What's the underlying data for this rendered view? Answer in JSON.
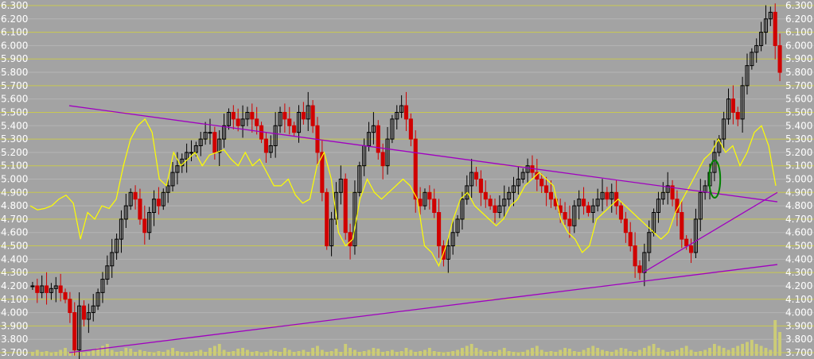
{
  "chart_data": {
    "type": "candlestick",
    "title": "",
    "xlabel": "",
    "ylabel": "",
    "ylim": [
      3.7,
      6.3
    ],
    "yticks": [
      "6.300",
      "6.200",
      "6.100",
      "6.000",
      "5.900",
      "5.800",
      "5.700",
      "5.600",
      "5.500",
      "5.400",
      "5.300",
      "5.200",
      "5.100",
      "5.000",
      "4.900",
      "4.800",
      "4.700",
      "4.600",
      "4.500",
      "4.400",
      "4.300",
      "4.200",
      "4.100",
      "4.000",
      "3.900",
      "3.800",
      "3.700"
    ],
    "grid": true,
    "legend": "none",
    "colors": {
      "background": "#a3a3a3",
      "up_candle": "#000000",
      "down_candle": "#d00000",
      "moving_average": "#ffff00",
      "trendline": "#a000c0",
      "volume": "#cccc77",
      "highlight": "#008000",
      "gridline_major": "#c8c850",
      "gridline_minor": "#b4b4b4"
    },
    "series": [
      {
        "kind": "close_approx",
        "values": [
          4.2,
          4.15,
          4.2,
          4.15,
          4.18,
          4.2,
          4.15,
          4.1,
          4.0,
          3.72,
          4.05,
          3.95,
          4.0,
          4.05,
          4.15,
          4.25,
          4.35,
          4.45,
          4.55,
          4.7,
          4.8,
          4.9,
          4.85,
          4.7,
          4.6,
          4.75,
          4.85,
          4.8,
          4.9,
          4.95,
          5.05,
          5.1,
          5.15,
          5.2,
          5.2,
          5.25,
          5.3,
          5.35,
          5.35,
          5.2,
          5.3,
          5.4,
          5.5,
          5.45,
          5.4,
          5.45,
          5.5,
          5.45,
          5.4,
          5.3,
          5.2,
          5.25,
          5.4,
          5.5,
          5.45,
          5.4,
          5.35,
          5.5,
          5.45,
          5.55,
          5.4,
          5.2,
          4.9,
          4.5,
          4.7,
          4.9,
          5.0,
          4.6,
          4.5,
          4.9,
          5.1,
          5.25,
          5.35,
          5.4,
          5.2,
          5.1,
          5.3,
          5.45,
          5.5,
          5.55,
          5.45,
          5.3,
          4.85,
          4.8,
          4.9,
          4.85,
          4.75,
          4.5,
          4.4,
          4.5,
          4.6,
          4.7,
          4.85,
          4.95,
          5.05,
          5.0,
          4.9,
          4.85,
          4.8,
          4.75,
          4.8,
          4.85,
          4.9,
          4.95,
          5.0,
          5.05,
          5.1,
          5.05,
          5.0,
          4.95,
          4.9,
          4.85,
          4.8,
          4.75,
          4.7,
          4.65,
          4.8,
          4.85,
          4.8,
          4.75,
          4.8,
          4.85,
          4.9,
          4.85,
          4.9,
          4.8,
          4.7,
          4.6,
          4.5,
          4.35,
          4.3,
          4.45,
          4.6,
          4.75,
          4.85,
          4.9,
          4.95,
          4.85,
          4.75,
          4.55,
          4.5,
          4.45,
          4.7,
          4.9,
          4.95,
          5.05,
          5.2,
          5.3,
          5.45,
          5.6,
          5.5,
          5.45,
          5.7,
          5.85,
          5.95,
          6.0,
          6.1,
          6.2,
          6.25,
          6.0,
          5.8
        ]
      },
      {
        "kind": "moving_average",
        "values": [
          4.8,
          4.77,
          4.78,
          4.8,
          4.85,
          4.88,
          4.82,
          4.55,
          4.75,
          4.7,
          4.8,
          4.78,
          4.85,
          5.1,
          5.3,
          5.4,
          5.45,
          5.35,
          5.0,
          4.95,
          5.2,
          5.1,
          5.15,
          5.2,
          5.1,
          5.18,
          5.2,
          5.22,
          5.15,
          5.1,
          5.2,
          5.1,
          5.15,
          5.05,
          4.95,
          4.95,
          5.0,
          4.88,
          4.82,
          4.85,
          5.1,
          5.2,
          5.0,
          4.6,
          4.5,
          4.55,
          4.85,
          5.0,
          4.9,
          4.85,
          4.9,
          4.95,
          5.0,
          4.95,
          4.85,
          4.5,
          4.45,
          4.35,
          4.5,
          4.7,
          4.85,
          4.9,
          4.8,
          4.75,
          4.7,
          4.65,
          4.7,
          4.8,
          4.85,
          4.95,
          5.0,
          5.05,
          5.0,
          4.95,
          4.7,
          4.6,
          4.55,
          4.45,
          4.5,
          4.7,
          4.75,
          4.8,
          4.85,
          4.8,
          4.75,
          4.7,
          4.65,
          4.6,
          4.55,
          4.6,
          4.75,
          4.85,
          4.95,
          5.05,
          5.15,
          5.2,
          5.3,
          5.2,
          5.25,
          5.1,
          5.2,
          5.35,
          5.4,
          5.25,
          4.95
        ]
      },
      {
        "kind": "volume_relative",
        "values": [
          0.1,
          0.15,
          0.1,
          0.12,
          0.08,
          0.1,
          0.15,
          0.2,
          0.1,
          0.12,
          0.1,
          0.08,
          0.1,
          0.15,
          0.2,
          0.25,
          0.3,
          0.15,
          0.1,
          0.12,
          0.2,
          0.18,
          0.1,
          0.15,
          0.12,
          0.1,
          0.08,
          0.12,
          0.1,
          0.15,
          0.2,
          0.12,
          0.1,
          0.08,
          0.1,
          0.12,
          0.15,
          0.1,
          0.2,
          0.25,
          0.3,
          0.15,
          0.1,
          0.12,
          0.18,
          0.2,
          0.15,
          0.1,
          0.12,
          0.08,
          0.1,
          0.15,
          0.12,
          0.1,
          0.2,
          0.15,
          0.1,
          0.12,
          0.15,
          0.1,
          0.2,
          0.25,
          0.15,
          0.1,
          0.12,
          0.18,
          0.1,
          0.3,
          0.2,
          0.15,
          0.1,
          0.12,
          0.15,
          0.2,
          0.18,
          0.1,
          0.12,
          0.15,
          0.1,
          0.12,
          0.2,
          0.15,
          0.1,
          0.12,
          0.15,
          0.2,
          0.12,
          0.1,
          0.08,
          0.1,
          0.12,
          0.15,
          0.2,
          0.25,
          0.3,
          0.2,
          0.15,
          0.1,
          0.12,
          0.1,
          0.15,
          0.2,
          0.12,
          0.1,
          0.08,
          0.1,
          0.15,
          0.2,
          0.25,
          0.15,
          0.1,
          0.12,
          0.1,
          0.15,
          0.2,
          0.18,
          0.12,
          0.1,
          0.15,
          0.2,
          0.25,
          0.2,
          0.15,
          0.12,
          0.1,
          0.15,
          0.2,
          0.18,
          0.12,
          0.1,
          0.15,
          0.2,
          0.25,
          0.3,
          0.2,
          0.15,
          0.1,
          0.12,
          0.15,
          0.2,
          0.25,
          0.15,
          0.1,
          0.12,
          0.15,
          0.2,
          0.3,
          0.25,
          0.2,
          0.15,
          0.2,
          0.25,
          0.3,
          0.35,
          0.4,
          0.3,
          0.25,
          0.2,
          0.15,
          0.9,
          0.6
        ]
      }
    ],
    "trendlines": [
      {
        "name": "",
        "from": [
          0.085,
          5.55
        ],
        "to": [
          0.955,
          4.83
        ]
      },
      {
        "name": "",
        "from": [
          0.085,
          3.7
        ],
        "to": [
          0.955,
          4.36
        ]
      },
      {
        "name": "",
        "from": [
          0.79,
          4.3
        ],
        "to": [
          0.955,
          4.9
        ]
      }
    ],
    "highlight": {
      "shape": "ellipse",
      "x": 0.878,
      "y_center": 5.0,
      "y_span": 0.28
    }
  }
}
